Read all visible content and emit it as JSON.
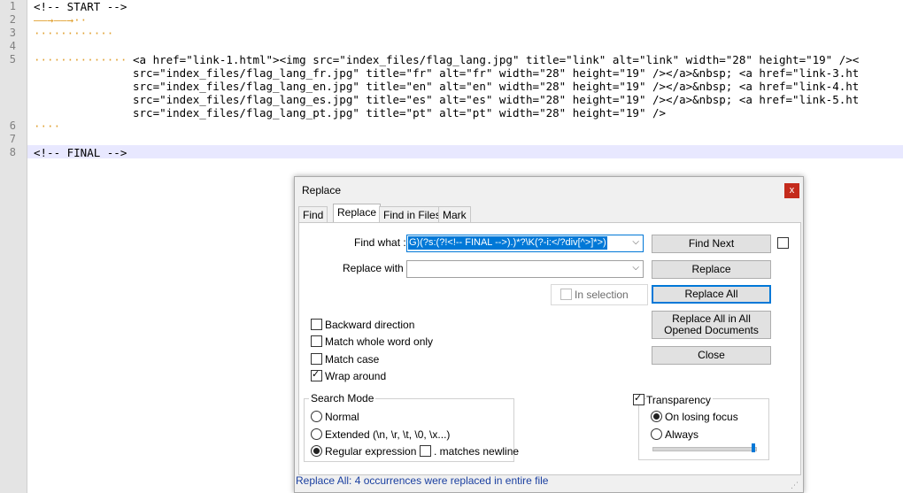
{
  "editor": {
    "line_numbers": [
      "1",
      "2",
      "3",
      "4",
      "5",
      "",
      "",
      "",
      "",
      "6",
      "7",
      "8"
    ],
    "lines": {
      "l1": "<!-- START -->",
      "l5a": "<a href=\"link-1.html\"><img src=\"index_files/flag_lang.jpg\" title=\"link\" alt=\"link\" width=\"28\" height=\"19\" /><",
      "l5b": "src=\"index_files/flag_lang_fr.jpg\" title=\"fr\" alt=\"fr\" width=\"28\" height=\"19\" /></a>&nbsp; <a href=\"link-3.ht",
      "l5c": "src=\"index_files/flag_lang_en.jpg\" title=\"en\" alt=\"en\" width=\"28\" height=\"19\" /></a>&nbsp; <a href=\"link-4.ht",
      "l5d": "src=\"index_files/flag_lang_es.jpg\" title=\"es\" alt=\"es\" width=\"28\" height=\"19\" /></a>&nbsp; <a href=\"link-5.ht",
      "l5e": "src=\"index_files/flag_lang_pt.jpg\" title=\"pt\" alt=\"pt\" width=\"28\" height=\"19\" />",
      "l8": "<!-- FINAL -->"
    }
  },
  "dialog": {
    "title": "Replace",
    "close_glyph": "x",
    "tabs": [
      "Find",
      "Replace",
      "Find in Files",
      "Mark"
    ],
    "find_label": "Find what :",
    "find_value": "G)(?s:(?!<!-- FINAL -->).)*?\\K(?-i:</?div[^>]*>)",
    "replace_label": "Replace with :",
    "replace_value": "",
    "in_selection": "In selection",
    "buttons": {
      "find_next": "Find Next",
      "replace": "Replace",
      "replace_all": "Replace All",
      "replace_all_opened": "Replace All in All Opened Documents",
      "close": "Close"
    },
    "options": {
      "backward": "Backward direction",
      "whole_word": "Match whole word only",
      "match_case": "Match case",
      "wrap": "Wrap around"
    },
    "search_mode": {
      "title": "Search Mode",
      "normal": "Normal",
      "extended": "Extended (\\n, \\r, \\t, \\0, \\x...)",
      "regex": "Regular expression",
      "dot_newline": ". matches newline"
    },
    "transparency": {
      "title": "Transparency",
      "on_losing_focus": "On losing focus",
      "always": "Always",
      "level": 1.0
    },
    "status": "Replace All: 4 occurrences were replaced in entire file"
  },
  "colors": {
    "accent": "#0078d7",
    "close": "#c42b1c",
    "status_text": "#1a3fa0"
  }
}
